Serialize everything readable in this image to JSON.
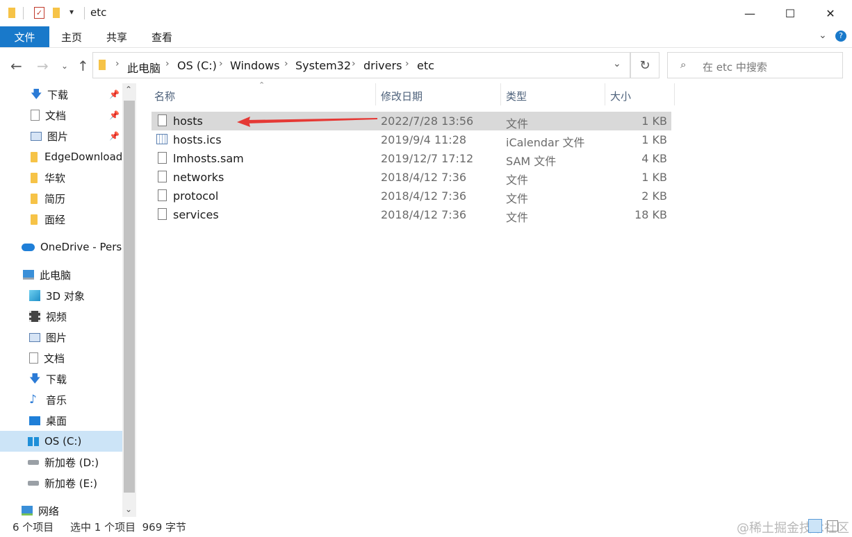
{
  "window": {
    "title": "etc"
  },
  "ribbon": {
    "tabs": [
      "文件",
      "主页",
      "共享",
      "查看"
    ]
  },
  "address": {
    "crumbs": [
      "此电脑",
      "OS (C:)",
      "Windows",
      "System32",
      "drivers",
      "etc"
    ]
  },
  "search": {
    "placeholder": "在 etc 中搜索"
  },
  "nav": {
    "quick": [
      "下载",
      "文档",
      "图片",
      "EdgeDownload",
      "华软",
      "简历",
      "面经"
    ],
    "onedrive": "OneDrive - Perso",
    "pc": "此电脑",
    "pc_items": [
      "3D 对象",
      "视频",
      "图片",
      "文档",
      "下载",
      "音乐",
      "桌面",
      "OS (C:)",
      "新加卷 (D:)",
      "新加卷 (E:)"
    ],
    "network": "网络"
  },
  "columns": {
    "name": "名称",
    "date": "修改日期",
    "type": "类型",
    "size": "大小"
  },
  "files": [
    {
      "name": "hosts",
      "date": "2022/7/28 13:56",
      "type": "文件",
      "size": "1 KB"
    },
    {
      "name": "hosts.ics",
      "date": "2019/9/4 11:28",
      "type": "iCalendar 文件",
      "size": "1 KB"
    },
    {
      "name": "lmhosts.sam",
      "date": "2019/12/7 17:12",
      "type": "SAM 文件",
      "size": "4 KB"
    },
    {
      "name": "networks",
      "date": "2018/4/12 7:36",
      "type": "文件",
      "size": "1 KB"
    },
    {
      "name": "protocol",
      "date": "2018/4/12 7:36",
      "type": "文件",
      "size": "2 KB"
    },
    {
      "name": "services",
      "date": "2018/4/12 7:36",
      "type": "文件",
      "size": "18 KB"
    }
  ],
  "status": {
    "count": "6 个项目",
    "selection": "选中 1 个项目  969 字节"
  },
  "watermark": "@稀土掘金技术社区",
  "colors": {
    "accent": "#1979ca",
    "selected_row": "#d9d9d9",
    "annotation_arrow": "#e53935"
  }
}
